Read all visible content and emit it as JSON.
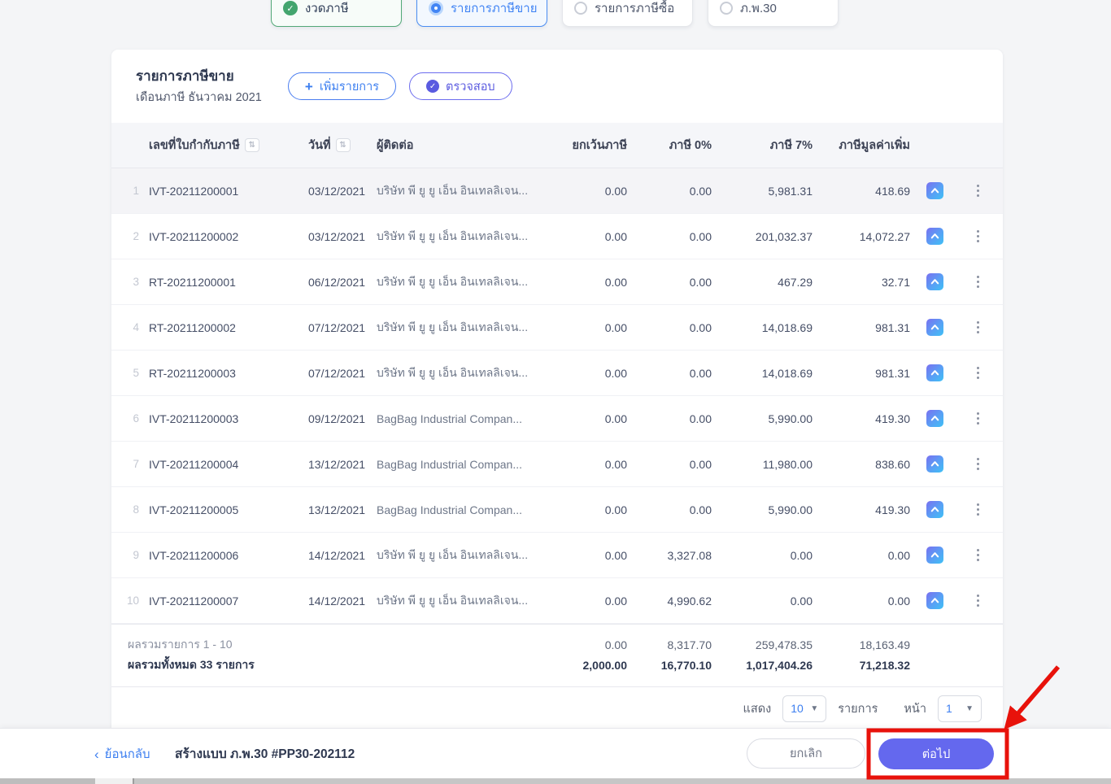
{
  "steps": [
    {
      "label": "งวดภาษี",
      "state": "done"
    },
    {
      "label": "รายการภาษีขาย",
      "state": "active"
    },
    {
      "label": "รายการภาษีซื้อ",
      "state": "idle"
    },
    {
      "label": "ภ.พ.30",
      "state": "idle"
    }
  ],
  "panel": {
    "title": "รายการภาษีขาย",
    "subtitle": "เดือนภาษี ธันวาคม 2021",
    "add_button": "เพิ่มรายการ",
    "verify_button": "ตรวจสอบ"
  },
  "table": {
    "headers": {
      "invoice": "เลขที่ใบกำกับภาษี",
      "date": "วันที่",
      "contact": "ผู้ติดต่อ",
      "exempt": "ยกเว้นภาษี",
      "tax0": "ภาษี 0%",
      "tax7": "ภาษี 7%",
      "vat": "ภาษีมูลค่าเพิ่ม"
    },
    "rows": [
      {
        "no": "1",
        "invoice": "IVT-20211200001",
        "date": "03/12/2021",
        "contact": "บริษัท พี ยู ยู เอ็น อินเทลลิเจน...",
        "exempt": "0.00",
        "tax0": "0.00",
        "tax7": "5,981.31",
        "vat": "418.69"
      },
      {
        "no": "2",
        "invoice": "IVT-20211200002",
        "date": "03/12/2021",
        "contact": "บริษัท พี ยู ยู เอ็น อินเทลลิเจน...",
        "exempt": "0.00",
        "tax0": "0.00",
        "tax7": "201,032.37",
        "vat": "14,072.27"
      },
      {
        "no": "3",
        "invoice": "RT-20211200001",
        "date": "06/12/2021",
        "contact": "บริษัท พี ยู ยู เอ็น อินเทลลิเจน...",
        "exempt": "0.00",
        "tax0": "0.00",
        "tax7": "467.29",
        "vat": "32.71"
      },
      {
        "no": "4",
        "invoice": "RT-20211200002",
        "date": "07/12/2021",
        "contact": "บริษัท พี ยู ยู เอ็น อินเทลลิเจน...",
        "exempt": "0.00",
        "tax0": "0.00",
        "tax7": "14,018.69",
        "vat": "981.31"
      },
      {
        "no": "5",
        "invoice": "RT-20211200003",
        "date": "07/12/2021",
        "contact": "บริษัท พี ยู ยู เอ็น อินเทลลิเจน...",
        "exempt": "0.00",
        "tax0": "0.00",
        "tax7": "14,018.69",
        "vat": "981.31"
      },
      {
        "no": "6",
        "invoice": "IVT-20211200003",
        "date": "09/12/2021",
        "contact": "BagBag Industrial Compan...",
        "exempt": "0.00",
        "tax0": "0.00",
        "tax7": "5,990.00",
        "vat": "419.30"
      },
      {
        "no": "7",
        "invoice": "IVT-20211200004",
        "date": "13/12/2021",
        "contact": "BagBag Industrial Compan...",
        "exempt": "0.00",
        "tax0": "0.00",
        "tax7": "11,980.00",
        "vat": "838.60"
      },
      {
        "no": "8",
        "invoice": "IVT-20211200005",
        "date": "13/12/2021",
        "contact": "BagBag Industrial Compan...",
        "exempt": "0.00",
        "tax0": "0.00",
        "tax7": "5,990.00",
        "vat": "419.30"
      },
      {
        "no": "9",
        "invoice": "IVT-20211200006",
        "date": "14/12/2021",
        "contact": "บริษัท พี ยู ยู เอ็น อินเทลลิเจน...",
        "exempt": "0.00",
        "tax0": "3,327.08",
        "tax7": "0.00",
        "vat": "0.00"
      },
      {
        "no": "10",
        "invoice": "IVT-20211200007",
        "date": "14/12/2021",
        "contact": "บริษัท พี ยู ยู เอ็น อินเทลลิเจน...",
        "exempt": "0.00",
        "tax0": "4,990.62",
        "tax7": "0.00",
        "vat": "0.00"
      }
    ],
    "summary_page": {
      "label": "ผลรวมรายการ 1 - 10",
      "exempt": "0.00",
      "tax0": "8,317.70",
      "tax7": "259,478.35",
      "vat": "18,163.49"
    },
    "summary_total": {
      "label": "ผลรวมทั้งหมด 33 รายการ",
      "exempt": "2,000.00",
      "tax0": "16,770.10",
      "tax7": "1,017,404.26",
      "vat": "71,218.32"
    }
  },
  "pagination": {
    "show_label": "แสดง",
    "page_size": "10",
    "items_label": "รายการ",
    "page_label": "หน้า",
    "page": "1"
  },
  "footer": {
    "back": "ย้อนกลับ",
    "title": "สร้างแบบ ภ.พ.30 #PP30-202112",
    "cancel": "ยกเลิก",
    "next": "ต่อไป"
  },
  "colors": {
    "accent_blue": "#3d7ff0",
    "accent_purple": "#5b5be0",
    "next_button": "#6468ee",
    "step_done_green": "#43a56e",
    "annotation_red": "#e8120b",
    "badge_gradient_start": "#7a70f0",
    "badge_gradient_end": "#3ec1f5"
  }
}
